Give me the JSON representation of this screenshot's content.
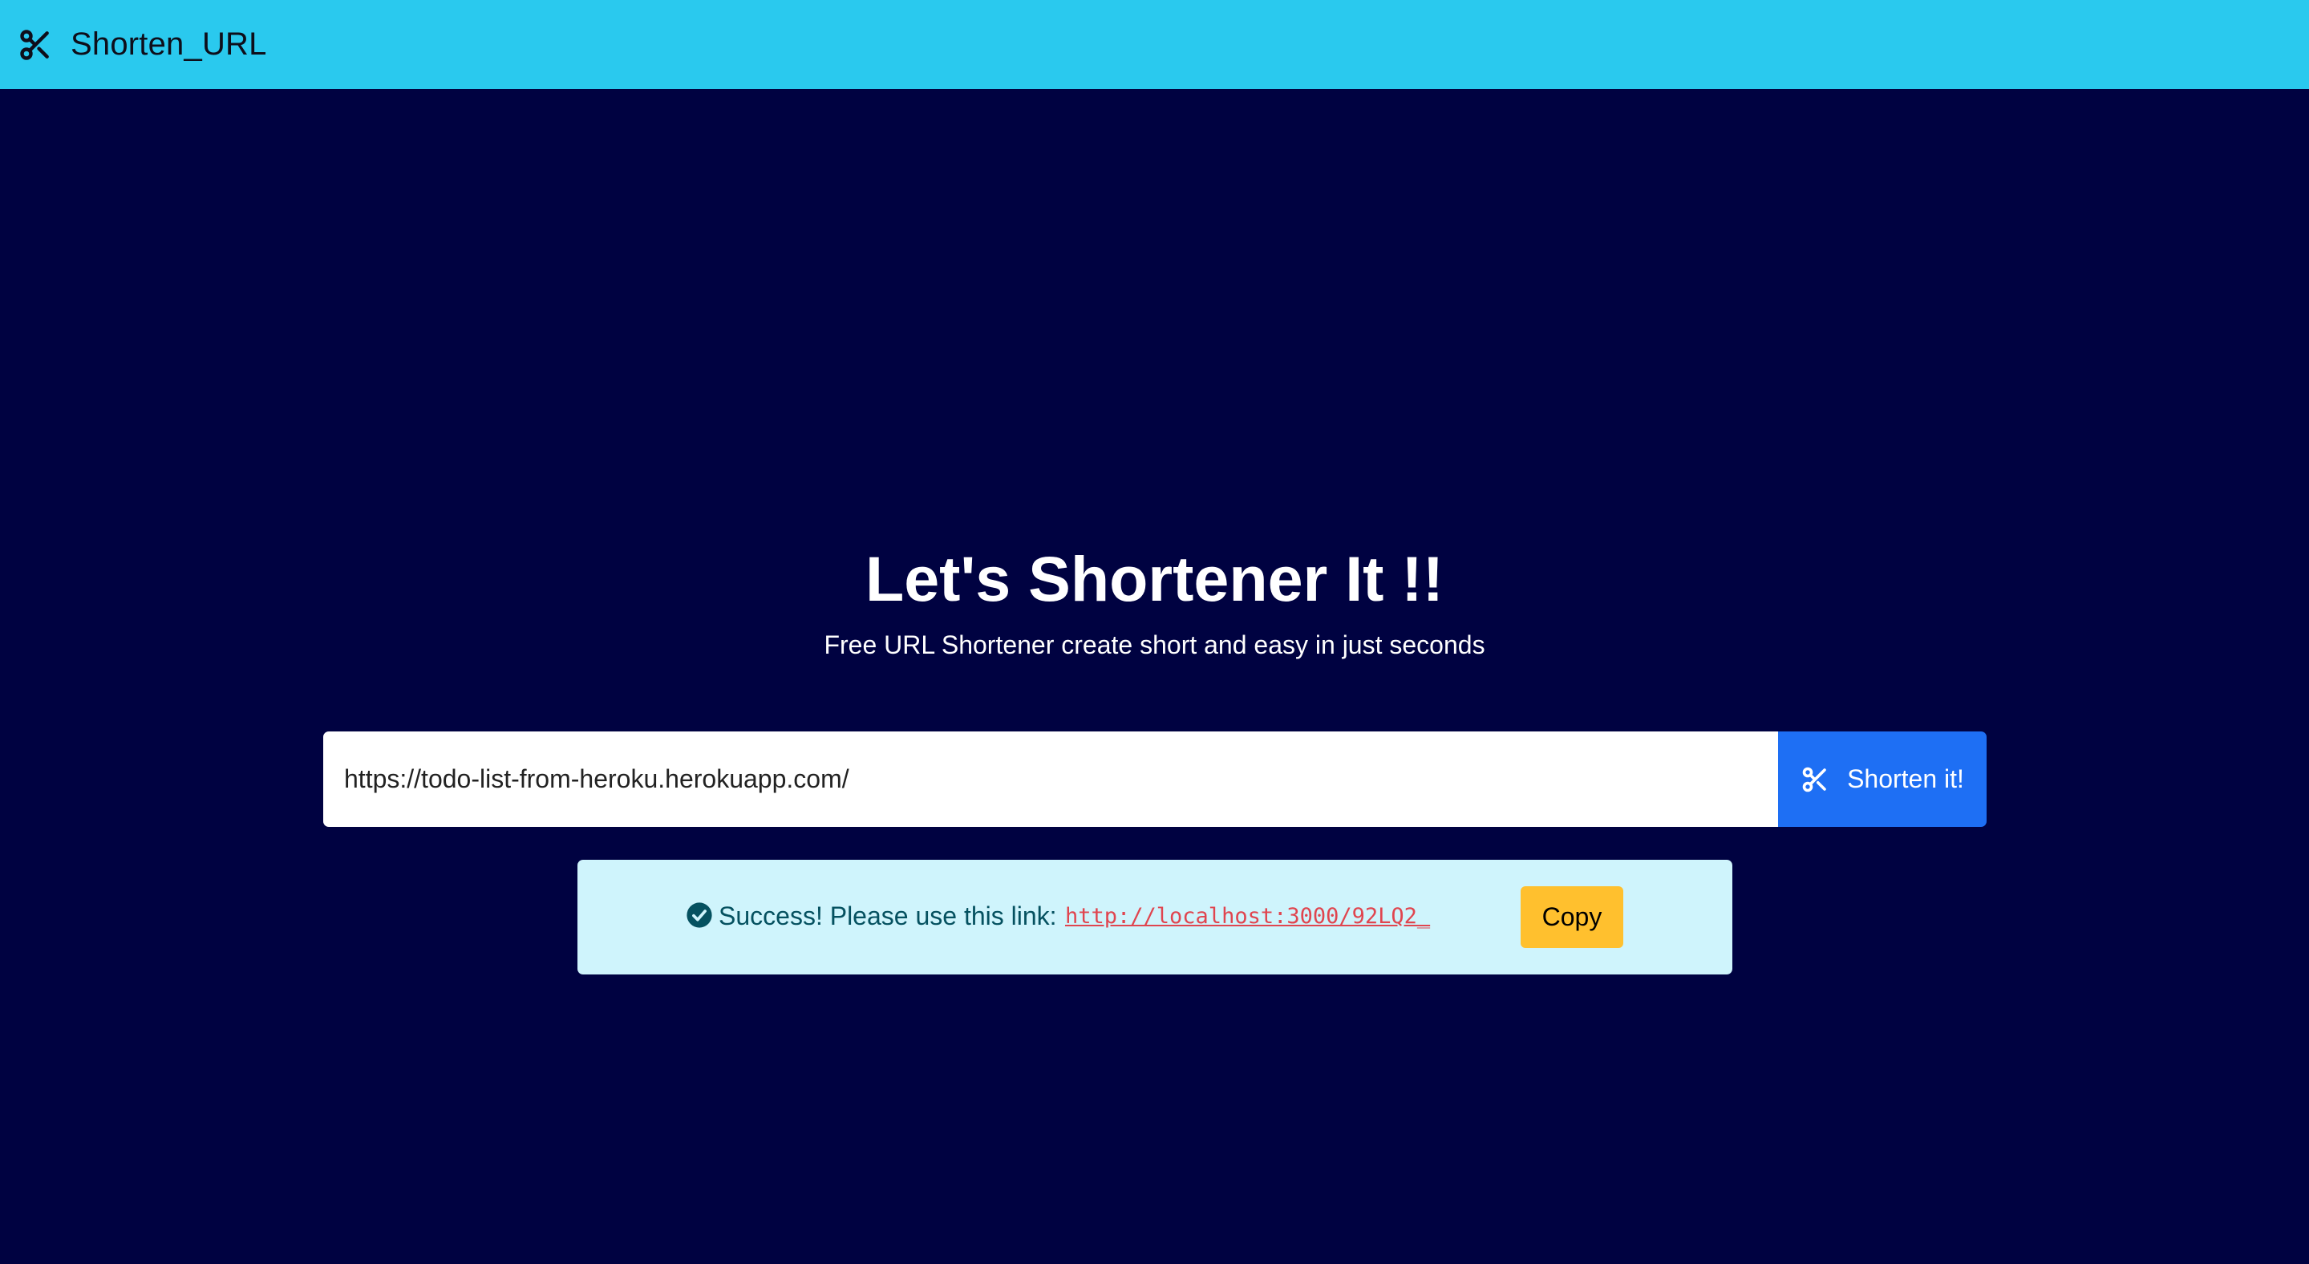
{
  "navbar": {
    "brand": "Shorten_URL",
    "brand_icon": "scissors-icon"
  },
  "hero": {
    "title": "Let's Shortener It !!",
    "subtitle": "Free URL Shortener create short and easy in just seconds"
  },
  "form": {
    "url_value": "https://todo-list-from-heroku.herokuapp.com/",
    "submit_label": "Shorten it!",
    "submit_icon": "scissors-icon"
  },
  "result": {
    "icon": "check-circle-icon",
    "message": "Success! Please use this link:",
    "short_link": "http://localhost:3000/92LQ2_",
    "copy_label": "Copy"
  },
  "colors": {
    "navbar_bg": "#2ac9ee",
    "page_bg": "#000241",
    "button_primary": "#1e6ff4",
    "alert_bg": "#cff4fc",
    "alert_text": "#055160",
    "link_color": "#e0454f",
    "copy_button": "#ffc02e"
  }
}
